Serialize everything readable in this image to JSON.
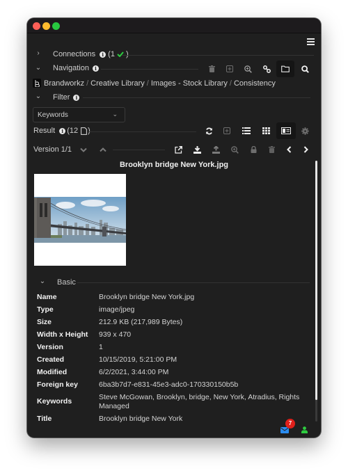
{
  "window": {
    "controls": [
      "close",
      "minimize",
      "zoom"
    ]
  },
  "toolbar": {
    "menu_icon": "hamburger-menu-icon"
  },
  "connections": {
    "label": "Connections",
    "count_prefix": "(1",
    "count_suffix": ")",
    "status_icon": "check-icon",
    "status_color": "#2ecc40",
    "expanded": false
  },
  "navigation": {
    "label": "Navigation",
    "expanded": true,
    "actions": [
      {
        "name": "delete",
        "icon": "trash-icon",
        "enabled": false
      },
      {
        "name": "add",
        "icon": "plus-square-icon",
        "enabled": false
      },
      {
        "name": "zoom",
        "icon": "zoom-in-icon",
        "enabled": true
      },
      {
        "name": "link",
        "icon": "link-icon",
        "enabled": true
      },
      {
        "name": "folder",
        "icon": "folder-icon",
        "enabled": true,
        "active": true
      },
      {
        "name": "search",
        "icon": "search-icon",
        "enabled": true
      }
    ]
  },
  "breadcrumb": {
    "items": [
      "Brandworkz",
      "Creative Library",
      "Images - Stock Library",
      "Consistency"
    ],
    "separator": "/"
  },
  "filter": {
    "label": "Filter",
    "expanded": true,
    "select_value": "Keywords"
  },
  "result": {
    "label": "Result",
    "count_prefix": "(12",
    "count_suffix": ")",
    "actions": [
      {
        "name": "refresh",
        "icon": "refresh-icon"
      },
      {
        "name": "add",
        "icon": "plus-square-icon"
      },
      {
        "name": "list-view",
        "icon": "list-icon"
      },
      {
        "name": "grid-view",
        "icon": "grid-icon"
      },
      {
        "name": "detail-view",
        "icon": "id-card-icon",
        "active": true
      },
      {
        "name": "settings",
        "icon": "gear-icon"
      }
    ]
  },
  "version": {
    "label": "Version 1/1",
    "actions": [
      {
        "name": "open-external",
        "icon": "external-link-icon"
      },
      {
        "name": "download",
        "icon": "download-icon"
      },
      {
        "name": "upload",
        "icon": "upload-icon"
      },
      {
        "name": "zoom",
        "icon": "zoom-in-icon"
      },
      {
        "name": "lock",
        "icon": "lock-icon"
      },
      {
        "name": "delete",
        "icon": "trash-icon"
      },
      {
        "name": "previous",
        "icon": "chevron-left-icon"
      },
      {
        "name": "next",
        "icon": "chevron-right-icon"
      }
    ]
  },
  "asset": {
    "file_name": "Brooklyn bridge New York.jpg",
    "thumbnail_alt": "Brooklyn bridge with Manhattan skyline"
  },
  "basic": {
    "label": "Basic",
    "properties": [
      {
        "key": "Name",
        "value": "Brooklyn bridge New York.jpg"
      },
      {
        "key": "Type",
        "value": "image/jpeg"
      },
      {
        "key": "Size",
        "value": "212.9 KB (217,989 Bytes)"
      },
      {
        "key": "Width x Height",
        "value": "939 x 470"
      },
      {
        "key": "Version",
        "value": "1"
      },
      {
        "key": "Created",
        "value": "10/15/2019, 5:21:00 PM"
      },
      {
        "key": "Modified",
        "value": "6/2/2021, 3:44:00 PM"
      },
      {
        "key": "Foreign key",
        "value": "6ba3b7d7-e831-45e3-adc0-170330150b5b"
      },
      {
        "key": "Keywords",
        "value": "Steve McGowan, Brooklyn, bridge, New York, Atradius, Rights Managed"
      },
      {
        "key": "Title",
        "value": "Brooklyn bridge New York"
      }
    ]
  },
  "status": {
    "messages_count": "7",
    "messages_color": "#2a8cf0",
    "badge_color": "#e0201b",
    "user_color": "#2ecc40"
  }
}
